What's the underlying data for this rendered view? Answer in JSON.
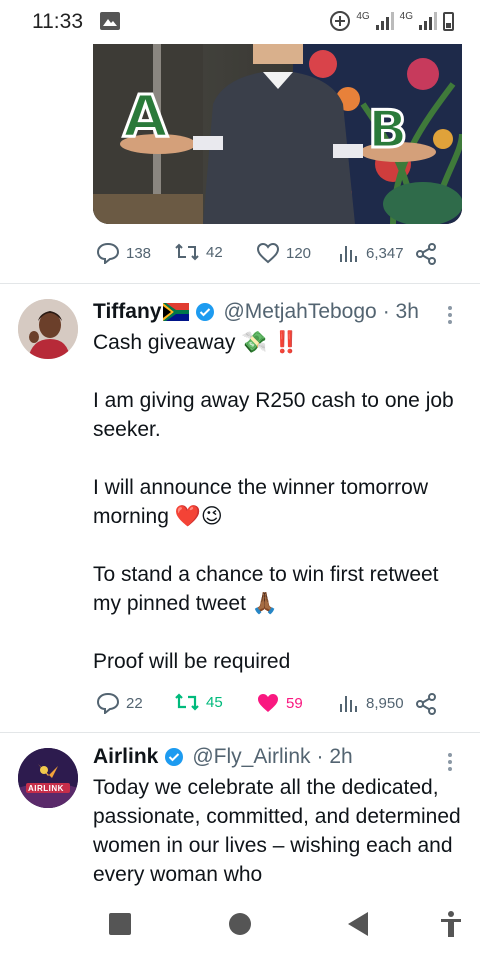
{
  "status_bar": {
    "time": "11:33",
    "network_1": "4G",
    "network_2": "4G",
    "icons": [
      "gallery-icon",
      "data-saver-icon",
      "signal-icon",
      "battery-icon"
    ]
  },
  "media": {
    "label_a": "A",
    "label_b": "B"
  },
  "tweet_prev": {
    "replies": "138",
    "retweets": "42",
    "likes": "120",
    "views": "6,347"
  },
  "tweet_1": {
    "name": "Tiffany",
    "handle": "@MetjahTebogo",
    "time": "· 3h",
    "text_line1": "Cash giveaway 💸 ‼️",
    "paragraph_1": "I am giving away R250 cash to one job seeker.",
    "paragraph_2": "I will announce the winner tomorrow morning ❤️😉",
    "paragraph_3": "To stand a chance to win first retweet my pinned tweet 🙏🏾",
    "paragraph_4": "Proof will be required",
    "replies": "22",
    "retweets": "45",
    "likes": "59",
    "views": "8,950",
    "retweet_color": "#00ba7c",
    "like_color": "#f91880"
  },
  "tweet_2": {
    "name": "Airlink",
    "handle": "@Fly_Airlink",
    "time": "· 2h",
    "avatar_text": "AIRLINK",
    "text": "Today we celebrate all the dedicated, passionate, committed, and determined women in our lives – wishing each and every woman who"
  },
  "colors": {
    "verified_blue": "#1d9bf0",
    "secondary_text": "#536471"
  }
}
